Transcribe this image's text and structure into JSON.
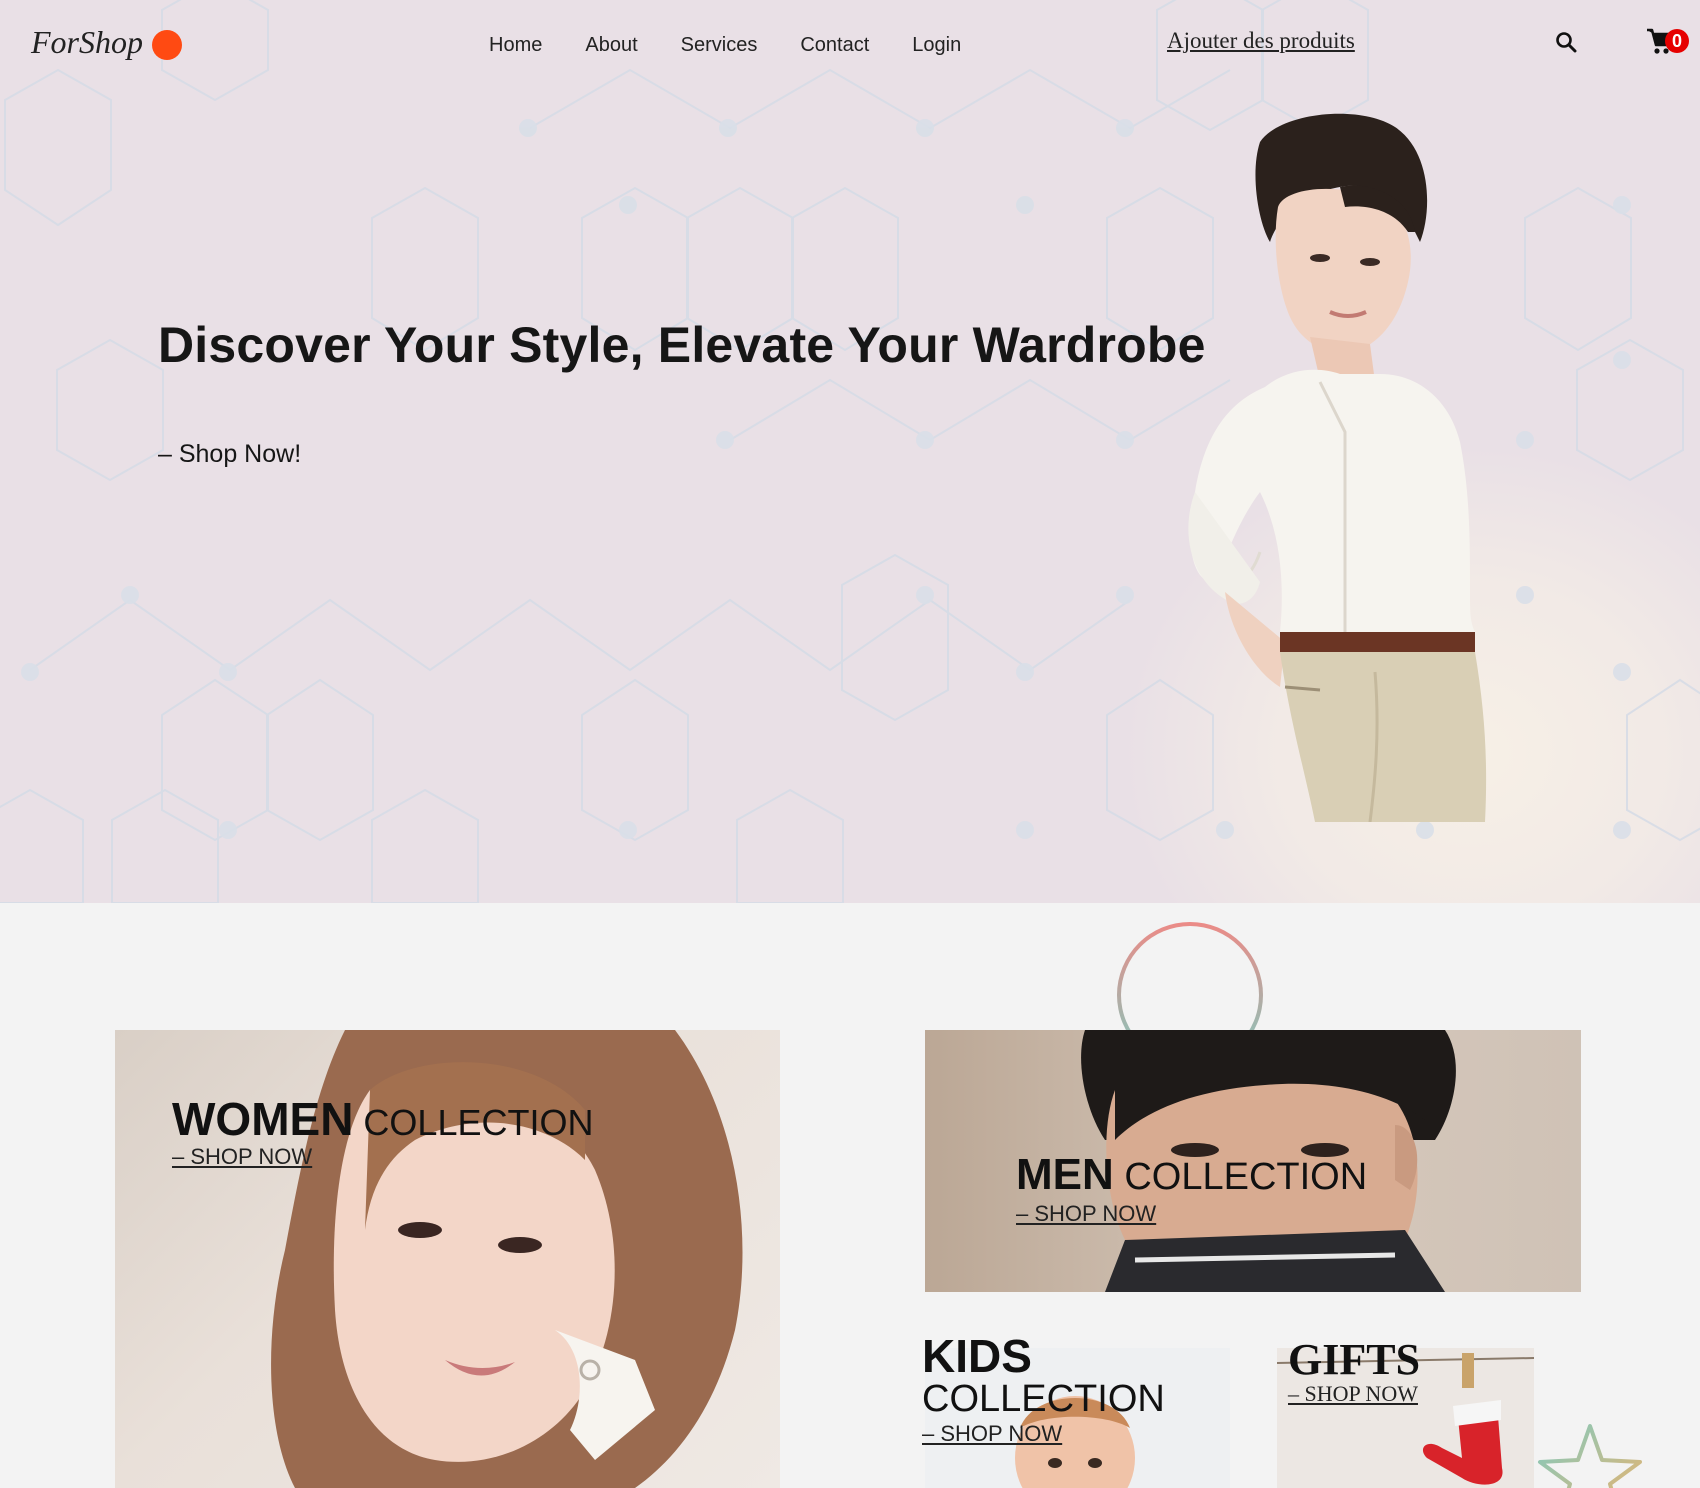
{
  "brand": {
    "name": "ForShop",
    "dot_color": "#ff4a12"
  },
  "nav": {
    "items": [
      {
        "label": "Home"
      },
      {
        "label": "About"
      },
      {
        "label": "Services"
      },
      {
        "label": "Contact"
      },
      {
        "label": "Login"
      }
    ],
    "add_products_label": "Ajouter des produits",
    "search_icon": "search-icon",
    "cart_icon": "cart-icon",
    "cart_count": "0",
    "cart_badge_color": "#e60000"
  },
  "hero": {
    "title": "Discover Your Style, Elevate Your Wardrobe",
    "cta": "– Shop Now!",
    "background": "#e9e0e6"
  },
  "collections": {
    "women": {
      "title_bold": "WOMEN",
      "title_rest": " COLLECTION",
      "cta": "– SHOP NOW"
    },
    "men": {
      "title_bold": "MEN",
      "title_rest": " COLLECTION",
      "cta": "– SHOP NOW"
    },
    "kids": {
      "title_line1": "KIDS",
      "title_line2": "COLLECTION",
      "cta": "– SHOP NOW"
    },
    "gifts": {
      "title": "GIFTS",
      "cta": "– SHOP NOW"
    }
  }
}
